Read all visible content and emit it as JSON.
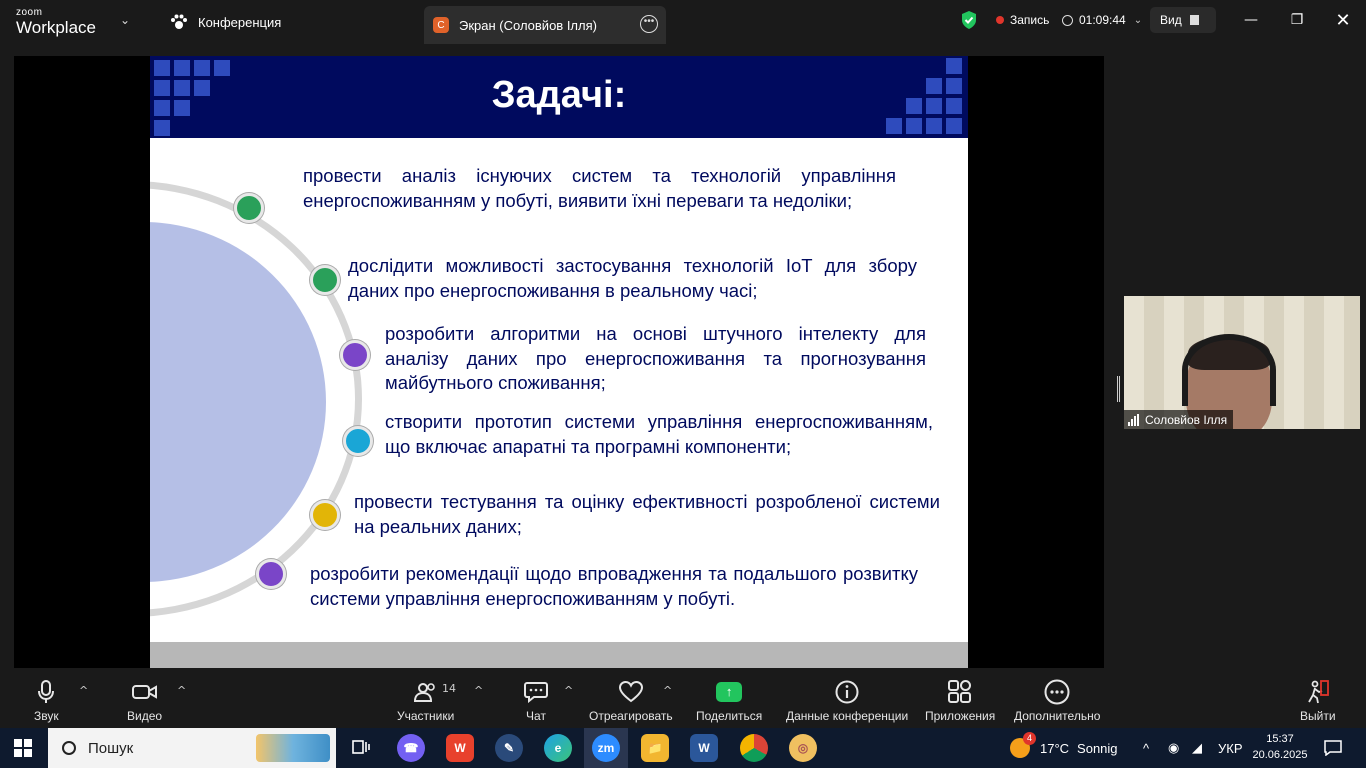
{
  "app": {
    "logo_small": "zoom",
    "logo_big": "Workplace"
  },
  "tabs": {
    "conference": "Конференция",
    "screen_share": "Экран (Соловйов Ілля)",
    "screen_avatar_letter": "С"
  },
  "status": {
    "recording_label": "Запись",
    "timer": "01:09:44",
    "view_label": "Вид"
  },
  "slide": {
    "title": "Задачі:",
    "items": [
      {
        "text": "провести аналіз існуючих систем та технологій управління енергоспоживанням у побуті, виявити їхні переваги та недоліки;",
        "bullet_color": "#2aa05a"
      },
      {
        "text": "дослідити можливості застосування технологій IoT для збору даних про енергоспоживання в реальному часі;",
        "bullet_color": "#2aa05a"
      },
      {
        "text": "розробити алгоритми на основі штучного інтелекту для аналізу даних про енергоспоживання та прогнозування майбутнього споживання;",
        "bullet_color": "#7a45c8"
      },
      {
        "text": "створити прототип системи управління енергоспоживанням, що включає апаратні та програмні компоненти;",
        "bullet_color": "#1aa6d6"
      },
      {
        "text": "провести тестування та оцінку ефективності розробленої системи на реальних даних;",
        "bullet_color": "#e2b507"
      },
      {
        "text": "розробити рекомендації щодо впровадження та подальшого розвитку системи управління енергоспоживанням у побуті.",
        "bullet_color": "#7a45c8"
      }
    ],
    "header_color": "#000a5e",
    "text_color": "#000a5e"
  },
  "video": {
    "participant_name": "Соловйов Ілля"
  },
  "controls": {
    "audio": "Звук",
    "video": "Видео",
    "participants": "Участники",
    "participants_count": "14",
    "chat": "Чат",
    "react": "Отреагировать",
    "share": "Поделиться",
    "meeting_info": "Данные конференции",
    "apps": "Приложения",
    "more": "Дополнительно",
    "leave": "Выйти"
  },
  "taskbar": {
    "search_placeholder": "Пошук",
    "weather_badge": "4",
    "weather_temp": "17°C",
    "weather_desc": "Sonnig",
    "language": "УКР",
    "time": "15:37",
    "date": "20.06.2025",
    "zoom_app_label": "zm"
  },
  "colors": {
    "accent_green": "#22c55e",
    "record_red": "#e0352b",
    "slide_circle": "#b5bfe6"
  }
}
